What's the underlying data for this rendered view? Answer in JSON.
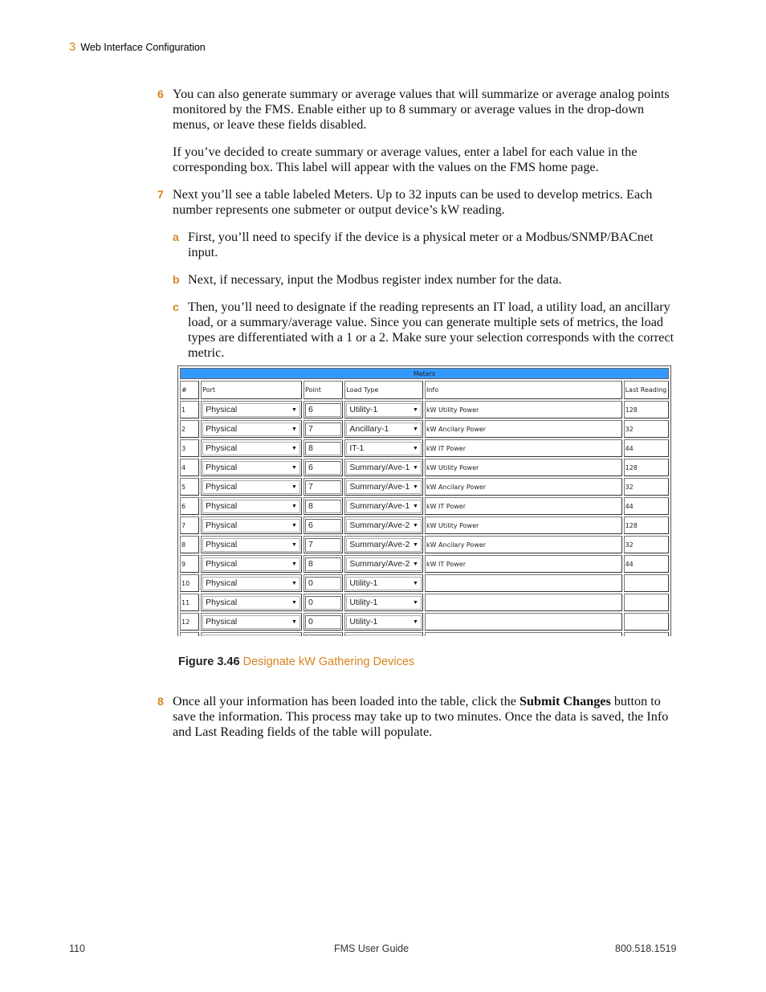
{
  "header": {
    "chapter": "3",
    "title": "Web Interface Configuration"
  },
  "steps": {
    "s6": {
      "num": "6",
      "p1": "You can also generate summary or average values that will summarize or average analog points monitored by the FMS. Enable either up to 8 summary or average values in the drop-down menus, or leave these fields disabled.",
      "p2": "If you’ve decided to create summary or average values, enter a label for each value in the corresponding box. This label will appear with the values on the FMS home page."
    },
    "s7": {
      "num": "7",
      "p1": "Next you’ll see a table labeled Meters. Up to 32 inputs can be used to develop metrics. Each number represents one submeter or output device’s kW reading.",
      "a": {
        "num": "a",
        "text": "First, you’ll need to specify if the device is a physical meter or a Modbus/SNMP/BACnet input."
      },
      "b": {
        "num": "b",
        "text": "Next, if necessary, input the Modbus register index number for the data."
      },
      "c": {
        "num": "c",
        "text": "Then, you’ll need to designate if the reading represents an IT load, a utility load, an ancillary load, or a summary/average value. Since you can generate multiple sets of metrics, the load types are differentiated with a 1 or a 2. Make sure your selection corresponds with the correct metric."
      }
    },
    "s8": {
      "num": "8",
      "pre": "Once all your information has been loaded into the table, click the ",
      "bold": "Submit Changes",
      "post": " button to save the information. This process may take up to two minutes. Once the data is saved, the Info and Last Reading fields of the table will populate."
    }
  },
  "meters": {
    "title": "Meters",
    "headers": {
      "num": "#",
      "port": "Port",
      "point": "Point",
      "load_type": "Load Type",
      "info": "Info",
      "last_reading": "Last Reading"
    },
    "rows": [
      {
        "num": "1",
        "port": "Physical",
        "point": "6",
        "load_type": "Utility-1",
        "info": "kW Utility Power",
        "last": "128"
      },
      {
        "num": "2",
        "port": "Physical",
        "point": "7",
        "load_type": "Ancillary-1",
        "info": "kW Ancilary Power",
        "last": "32"
      },
      {
        "num": "3",
        "port": "Physical",
        "point": "8",
        "load_type": "IT-1",
        "info": "kW IT Power",
        "last": "44"
      },
      {
        "num": "4",
        "port": "Physical",
        "point": "6",
        "load_type": "Summary/Ave-1",
        "info": "kW Utility Power",
        "last": "128"
      },
      {
        "num": "5",
        "port": "Physical",
        "point": "7",
        "load_type": "Summary/Ave-1",
        "info": "kW Ancilary Power",
        "last": "32"
      },
      {
        "num": "6",
        "port": "Physical",
        "point": "8",
        "load_type": "Summary/Ave-1",
        "info": "kW IT Power",
        "last": "44"
      },
      {
        "num": "7",
        "port": "Physical",
        "point": "6",
        "load_type": "Summary/Ave-2",
        "info": "kW Utility Power",
        "last": "128"
      },
      {
        "num": "8",
        "port": "Physical",
        "point": "7",
        "load_type": "Summary/Ave-2",
        "info": "kW Ancilary Power",
        "last": "32"
      },
      {
        "num": "9",
        "port": "Physical",
        "point": "8",
        "load_type": "Summary/Ave-2",
        "info": "kW IT Power",
        "last": "44"
      },
      {
        "num": "10",
        "port": "Physical",
        "point": "0",
        "load_type": "Utility-1",
        "info": "",
        "last": ""
      },
      {
        "num": "11",
        "port": "Physical",
        "point": "0",
        "load_type": "Utility-1",
        "info": "",
        "last": ""
      },
      {
        "num": "12",
        "port": "Physical",
        "point": "0",
        "load_type": "Utility-1",
        "info": "",
        "last": ""
      },
      {
        "num": "",
        "port": "",
        "point": "",
        "load_type": "",
        "info": "",
        "last": ""
      }
    ],
    "dropdown_arrow": "▼"
  },
  "figure": {
    "label": "Figure 3.46",
    "title": "Designate kW Gathering Devices"
  },
  "footer": {
    "page": "110",
    "guide": "FMS User Guide",
    "phone": "800.518.1519"
  },
  "colors": {
    "accent": "#d8821e",
    "table_title_bg": "#3399ff"
  }
}
